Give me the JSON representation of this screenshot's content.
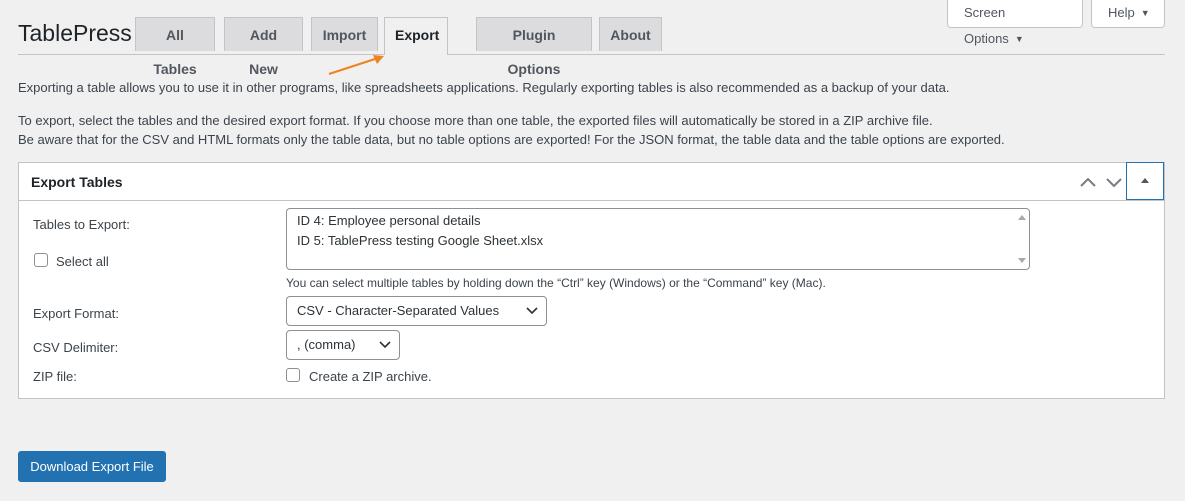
{
  "header": {
    "app_title": "TablePress",
    "tabs": [
      {
        "label": "All Tables"
      },
      {
        "label": "Add New"
      },
      {
        "label": "Import"
      },
      {
        "label": "Export"
      },
      {
        "label": "Plugin Options"
      },
      {
        "label": "About"
      }
    ],
    "active_tab": "Export",
    "screen_options_label": "Screen Options",
    "help_label": "Help"
  },
  "intro": {
    "line1": "Exporting a table allows you to use it in other programs, like spreadsheets applications. Regularly exporting tables is also recommended as a backup of your data.",
    "line2": "To export, select the tables and the desired export format. If you choose more than one table, the exported files will automatically be stored in a ZIP archive file.",
    "line3": "Be aware that for the CSV and HTML formats only the table data, but no table options are exported! For the JSON format, the table data and the table options are exported."
  },
  "panel": {
    "title": "Export Tables",
    "tables_label": "Tables to Export:",
    "select_all_label": "Select all",
    "tables": [
      "ID 4: Employee personal details",
      "ID 5: TablePress testing Google Sheet.xlsx"
    ],
    "tables_help": "You can select multiple tables by holding down the “Ctrl” key (Windows) or the “Command” key (Mac).",
    "format_label": "Export Format:",
    "format_value": "CSV - Character-Separated Values",
    "delimiter_label": "CSV Delimiter:",
    "delimiter_value": ", (comma)",
    "zip_label": "ZIP file:",
    "zip_checkbox_label": "Create a ZIP archive.",
    "zip_checked": false,
    "select_all_checked": false
  },
  "download_button_label": "Download Export File",
  "colors": {
    "accent": "#2271b1",
    "annotation_arrow": "#f0821e"
  }
}
